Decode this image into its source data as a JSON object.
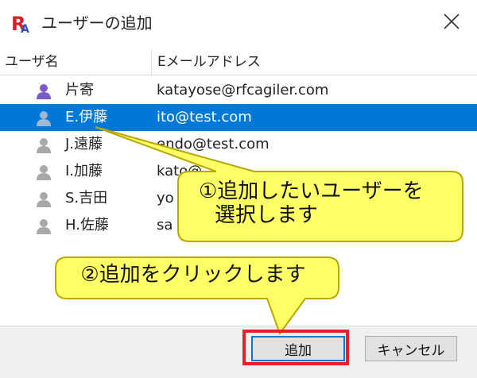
{
  "window": {
    "title": "ユーザーの追加"
  },
  "columns": {
    "name": "ユーザ名",
    "email": "Eメールアドレス"
  },
  "users": [
    {
      "name": "片寄",
      "email": "katayose@rfcagiler.com",
      "selected": false,
      "icon_color": "#7b5cc7"
    },
    {
      "name": "E.伊藤",
      "email": "ito@test.com",
      "selected": true,
      "icon_color": "#9fb8d4"
    },
    {
      "name": "J.遠藤",
      "email": "endo@test.com",
      "selected": false,
      "icon_color": "#a8a8a8"
    },
    {
      "name": "I.加藤",
      "email": "kato@",
      "selected": false,
      "icon_color": "#a8a8a8"
    },
    {
      "name": "S.吉田",
      "email": "yo",
      "selected": false,
      "icon_color": "#a8a8a8"
    },
    {
      "name": "H.佐藤",
      "email": "sa",
      "selected": false,
      "icon_color": "#a8a8a8"
    }
  ],
  "buttons": {
    "add": "追加",
    "cancel": "キャンセル"
  },
  "annotations": {
    "callout1_line1": "①追加したいユーザーを",
    "callout1_line2": "選択します",
    "callout2": "②追加をクリックします"
  },
  "colors": {
    "selection": "#0078d7",
    "callout_fill": "#ffff66",
    "callout_border": "#b8a800",
    "highlight_box": "#ee1c25"
  }
}
